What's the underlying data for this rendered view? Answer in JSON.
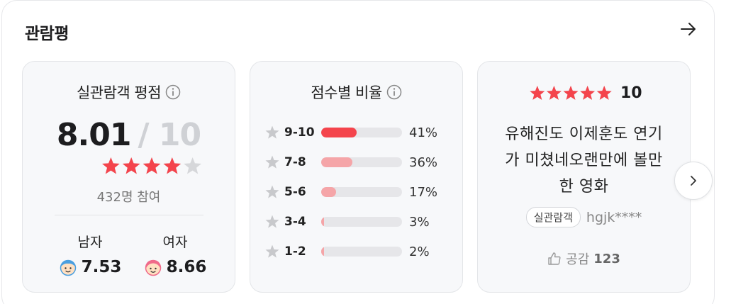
{
  "section": {
    "title": "관람평"
  },
  "rating_card": {
    "title": "실관람객 평점",
    "score": "8.01",
    "max": "/ 10",
    "star_rating": 0.801,
    "participants": "432명 참여",
    "male": {
      "label": "남자",
      "score": "7.53"
    },
    "female": {
      "label": "여자",
      "score": "8.66"
    }
  },
  "distribution_card": {
    "title": "점수별 비율",
    "rows": [
      {
        "label": "9-10",
        "pct": "41%",
        "value": 41,
        "color": "#f4444c"
      },
      {
        "label": "7-8",
        "pct": "36%",
        "value": 36,
        "color": "#f5a5a8"
      },
      {
        "label": "5-6",
        "pct": "17%",
        "value": 17,
        "color": "#f5a5a8"
      },
      {
        "label": "3-4",
        "pct": "3%",
        "value": 3,
        "color": "#f5a5a8"
      },
      {
        "label": "1-2",
        "pct": "2%",
        "value": 2,
        "color": "#f5a5a8"
      }
    ]
  },
  "review_card": {
    "score": "10",
    "star_rating": 1.0,
    "lines": [
      "유해진도 이제훈도 연기",
      "가 미쳤네오랜만에 볼만",
      "한 영화"
    ],
    "badge": "실관람객",
    "author": "hgjk****",
    "like_label": "공감",
    "like_count": "123"
  },
  "colors": {
    "accent": "#f4444c",
    "star_off": "#d6d7da"
  },
  "icons": [
    "arrow-right-icon",
    "info-icon",
    "star-icon",
    "male-face-icon",
    "female-face-icon",
    "thumbs-up-icon",
    "chevron-right-icon"
  ]
}
